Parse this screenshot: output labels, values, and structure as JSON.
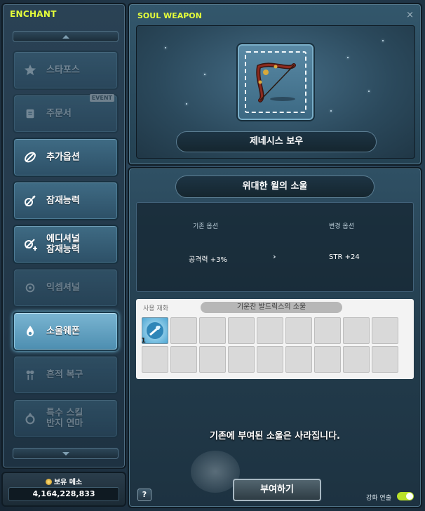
{
  "left_panel": {
    "title": "ENCHANT",
    "menu": [
      {
        "label": "스타포스",
        "icon": "star-icon",
        "state": "disabled"
      },
      {
        "label": "주문서",
        "icon": "scroll-icon",
        "state": "disabled",
        "badge": "EVENT"
      },
      {
        "label": "추가옵션",
        "icon": "flame-icon",
        "state": "normal"
      },
      {
        "label": "잠재능력",
        "icon": "potential-icon",
        "state": "normal"
      },
      {
        "label": "에디셔널\n잠재능력",
        "icon": "additional-potential-icon",
        "state": "normal"
      },
      {
        "label": "익셉셔널",
        "icon": "exceptional-icon",
        "state": "disabled"
      },
      {
        "label": "소울웨폰",
        "icon": "soul-icon",
        "state": "active"
      },
      {
        "label": "흔적 복구",
        "icon": "restore-icon",
        "state": "disabled"
      },
      {
        "label": "특수 스킬\n반지 연마",
        "icon": "ring-icon",
        "state": "disabled"
      }
    ]
  },
  "money": {
    "label": "보유 메소",
    "value": "4,164,228,833"
  },
  "soul_weapon": {
    "title": "SOUL WEAPON",
    "close_label": "×",
    "weapon_name": "제네시스 보우"
  },
  "soul": {
    "name": "위대한 윌의 소울",
    "current_option_header": "기존 옵션",
    "new_option_header": "변경 옵션",
    "current_option_value": "공격력 +3%",
    "new_option_value": "STR +24",
    "arrow": "›"
  },
  "materials": {
    "label": "사용 재화",
    "name": "기운찬 발드릭스의 소울",
    "first_slot_count": "1",
    "slot_count": 18
  },
  "footer": {
    "warning": "기존에 부여된 소울은 사라집니다.",
    "help_label": "?",
    "apply_label": "부여하기",
    "toggle_label": "강화 연출",
    "toggle_on": true
  },
  "colors": {
    "title_accent": "#e6ff3a",
    "toggle_on": "#b9e02a"
  }
}
